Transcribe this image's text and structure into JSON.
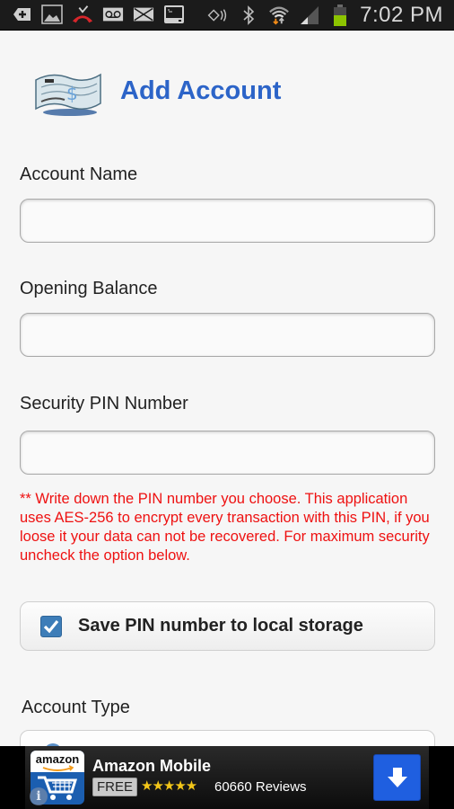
{
  "status_bar": {
    "left_icons": [
      "add-notification-icon",
      "gallery-icon",
      "missed-call-icon",
      "voicemail-icon",
      "email-icon",
      "terminal-icon"
    ],
    "right_icons": [
      "nfc-icon",
      "bluetooth-icon",
      "wifi-icon",
      "signal-icon",
      "battery-icon"
    ],
    "time": "7:02 PM"
  },
  "header": {
    "title": "Add Account",
    "logo_icon": "check-icon"
  },
  "form": {
    "account_name": {
      "label": "Account Name",
      "value": "",
      "placeholder": ""
    },
    "opening_balance": {
      "label": "Opening Balance",
      "value": "",
      "placeholder": ""
    },
    "security_pin": {
      "label": "Security PIN Number",
      "value": "",
      "placeholder": ""
    },
    "warning": "** Write down the PIN number you choose. This application uses AES-256 to encrypt every transaction with this PIN, if you loose it your data can not be recovered. For maximum security uncheck the option below.",
    "save_pin": {
      "label": "Save PIN number to local storage",
      "checked": true
    },
    "account_type": {
      "label": "Account Type"
    }
  },
  "ad": {
    "brand": "amazon",
    "title": "Amazon Mobile",
    "price_badge": "FREE",
    "rating": 4.5,
    "stars": "★★★★★",
    "reviews": "60660 Reviews",
    "colors": {
      "download_button": "#1f5fe0",
      "stars": "#f3c619"
    }
  },
  "colors": {
    "title": "#2c64c8",
    "warning": "#ee1111",
    "checkbox": "#3d7db8"
  }
}
